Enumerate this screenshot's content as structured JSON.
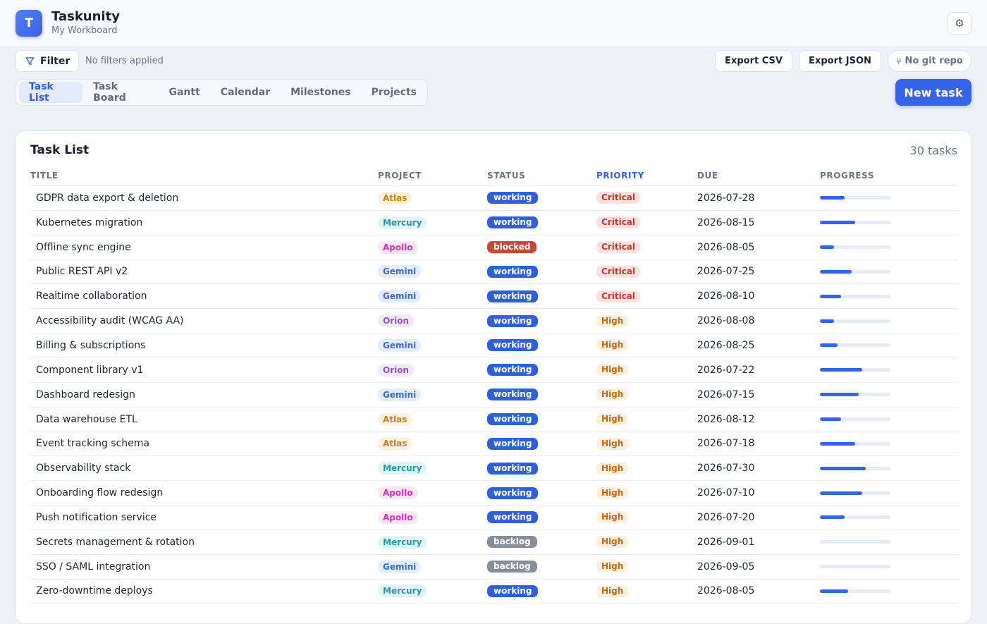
{
  "app": {
    "logo_letter": "T",
    "title": "Taskunity",
    "subtitle": "My Workboard",
    "settings_icon": "gear-icon"
  },
  "toolbar": {
    "filter_label": "Filter",
    "filter_status": "No filters applied",
    "export_csv": "Export CSV",
    "export_json": "Export JSON",
    "git_label": "No git repo"
  },
  "tabs": [
    {
      "label": "Task List",
      "active": true
    },
    {
      "label": "Task Board",
      "active": false
    },
    {
      "label": "Gantt",
      "active": false
    },
    {
      "label": "Calendar",
      "active": false
    },
    {
      "label": "Milestones",
      "active": false
    },
    {
      "label": "Projects",
      "active": false
    }
  ],
  "new_task_label": "New task",
  "task_list": {
    "title": "Task List",
    "count_label": "30 tasks",
    "columns": [
      "TITLE",
      "PROJECT",
      "STATUS",
      "PRIORITY",
      "DUE",
      "PROGRESS"
    ],
    "sorted_column": "PRIORITY"
  },
  "colors": {
    "accent": "#3563e9",
    "projects": {
      "Atlas": {
        "bg": "#fcf1de",
        "fg": "#c98418"
      },
      "Mercury": {
        "bg": "#e0f5f7",
        "fg": "#2c97a8"
      },
      "Apollo": {
        "bg": "#fde5f6",
        "fg": "#d433b6"
      },
      "Gemini": {
        "bg": "#e3ecfb",
        "fg": "#3c6bc9"
      },
      "Orion": {
        "bg": "#f1e9fa",
        "fg": "#8a55c8"
      }
    },
    "status": {
      "working": "#2f5fdb",
      "blocked": "#c9473b",
      "backlog": "#878d99"
    },
    "priority": {
      "Critical": {
        "bg": "#fbe1df",
        "fg": "#c53a31"
      },
      "High": {
        "bg": "#fdf0e0",
        "fg": "#c46a12"
      }
    }
  },
  "tasks": [
    {
      "title": "GDPR data export & deletion",
      "project": "Atlas",
      "status": "working",
      "priority": "Critical",
      "due": "2026-07-28",
      "progress": 0.35
    },
    {
      "title": "Kubernetes migration",
      "project": "Mercury",
      "status": "working",
      "priority": "Critical",
      "due": "2026-08-15",
      "progress": 0.5
    },
    {
      "title": "Offline sync engine",
      "project": "Apollo",
      "status": "blocked",
      "priority": "Critical",
      "due": "2026-08-05",
      "progress": 0.2
    },
    {
      "title": "Public REST API v2",
      "project": "Gemini",
      "status": "working",
      "priority": "Critical",
      "due": "2026-07-25",
      "progress": 0.45
    },
    {
      "title": "Realtime collaboration",
      "project": "Gemini",
      "status": "working",
      "priority": "Critical",
      "due": "2026-08-10",
      "progress": 0.3
    },
    {
      "title": "Accessibility audit (WCAG AA)",
      "project": "Orion",
      "status": "working",
      "priority": "High",
      "due": "2026-08-08",
      "progress": 0.2
    },
    {
      "title": "Billing & subscriptions",
      "project": "Gemini",
      "status": "working",
      "priority": "High",
      "due": "2026-08-25",
      "progress": 0.25
    },
    {
      "title": "Component library v1",
      "project": "Orion",
      "status": "working",
      "priority": "High",
      "due": "2026-07-22",
      "progress": 0.6
    },
    {
      "title": "Dashboard redesign",
      "project": "Gemini",
      "status": "working",
      "priority": "High",
      "due": "2026-07-15",
      "progress": 0.55
    },
    {
      "title": "Data warehouse ETL",
      "project": "Atlas",
      "status": "working",
      "priority": "High",
      "due": "2026-08-12",
      "progress": 0.3
    },
    {
      "title": "Event tracking schema",
      "project": "Atlas",
      "status": "working",
      "priority": "High",
      "due": "2026-07-18",
      "progress": 0.5
    },
    {
      "title": "Observability stack",
      "project": "Mercury",
      "status": "working",
      "priority": "High",
      "due": "2026-07-30",
      "progress": 0.65
    },
    {
      "title": "Onboarding flow redesign",
      "project": "Apollo",
      "status": "working",
      "priority": "High",
      "due": "2026-07-10",
      "progress": 0.6
    },
    {
      "title": "Push notification service",
      "project": "Apollo",
      "status": "working",
      "priority": "High",
      "due": "2026-07-20",
      "progress": 0.35
    },
    {
      "title": "Secrets management & rotation",
      "project": "Mercury",
      "status": "backlog",
      "priority": "High",
      "due": "2026-09-01",
      "progress": 0
    },
    {
      "title": "SSO / SAML integration",
      "project": "Gemini",
      "status": "backlog",
      "priority": "High",
      "due": "2026-09-05",
      "progress": 0
    },
    {
      "title": "Zero-downtime deploys",
      "project": "Mercury",
      "status": "working",
      "priority": "High",
      "due": "2026-08-05",
      "progress": 0.4
    }
  ]
}
